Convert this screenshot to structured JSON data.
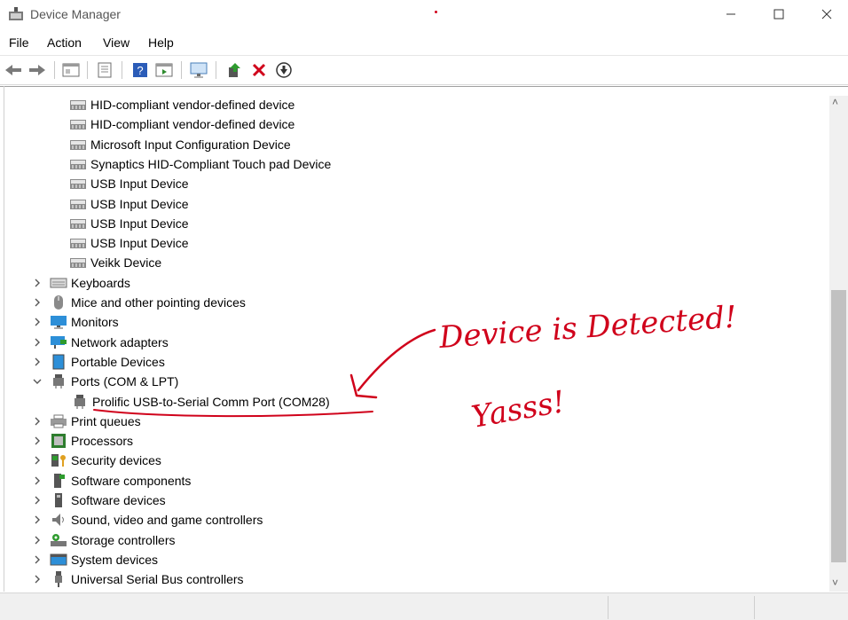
{
  "window": {
    "title": "Device Manager"
  },
  "menu": [
    "File",
    "Action",
    "View",
    "Help"
  ],
  "toolbar": {
    "buttons": [
      "back-icon",
      "forward-icon",
      "properties-icon",
      "refresh-icon",
      "help-icon",
      "view-icon",
      "monitor-scan-icon",
      "update-driver-icon",
      "uninstall-icon",
      "disable-icon"
    ]
  },
  "tree": {
    "hid_children": [
      "HID-compliant vendor-defined device",
      "HID-compliant vendor-defined device",
      "Microsoft Input Configuration Device",
      "Synaptics HID-Compliant Touch pad Device",
      "USB Input Device",
      "USB Input Device",
      "USB Input Device",
      "USB Input Device",
      "Veikk Device"
    ],
    "categories_top": [
      {
        "label": "Keyboards",
        "icon": "keyboard-icon"
      },
      {
        "label": "Mice and other pointing devices",
        "icon": "mouse-icon"
      },
      {
        "label": "Monitors",
        "icon": "monitor-icon"
      },
      {
        "label": "Network adapters",
        "icon": "network-icon"
      },
      {
        "label": "Portable Devices",
        "icon": "portable-icon"
      }
    ],
    "ports": {
      "label": "Ports (COM & LPT)",
      "child": "Prolific USB-to-Serial Comm Port (COM28)"
    },
    "categories_bottom": [
      {
        "label": "Print queues",
        "icon": "printer-icon"
      },
      {
        "label": "Processors",
        "icon": "processor-icon"
      },
      {
        "label": "Security devices",
        "icon": "security-icon"
      },
      {
        "label": "Software components",
        "icon": "software-component-icon"
      },
      {
        "label": "Software devices",
        "icon": "software-device-icon"
      },
      {
        "label": "Sound, video and game controllers",
        "icon": "sound-icon"
      },
      {
        "label": "Storage controllers",
        "icon": "storage-icon"
      },
      {
        "label": "System devices",
        "icon": "system-icon"
      },
      {
        "label": "Universal Serial Bus controllers",
        "icon": "usb-icon"
      }
    ]
  },
  "annotation": {
    "line1": "Device is Detected!",
    "line2": "Yasss!",
    "color": "#d0021b"
  }
}
